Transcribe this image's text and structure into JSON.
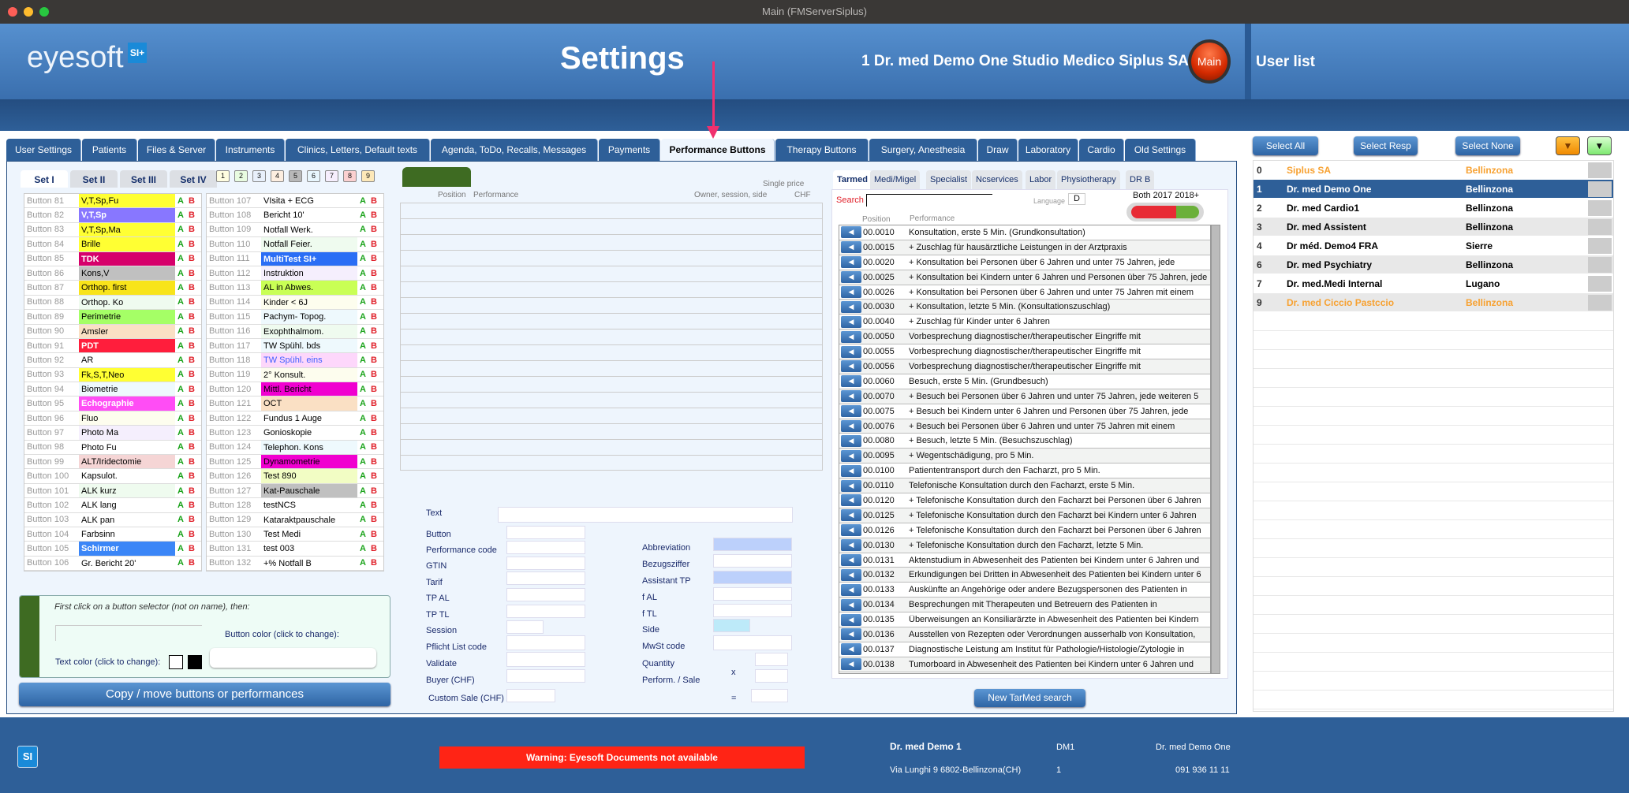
{
  "window": {
    "title": "Main (FMServerSiplus)"
  },
  "header": {
    "logo": "eyesoft",
    "logo_badge": "SI+",
    "title": "Settings",
    "user_clinic": "1 Dr. med Demo One  Studio Medico Siplus SA",
    "main_button": "Main",
    "user_list_title": "User list"
  },
  "tabs": [
    "User Settings",
    "Patients",
    "Files & Server",
    "Instruments",
    "Clinics, Letters, Default texts",
    "Agenda, ToDo, Recalls, Messages",
    "Payments",
    "Performance Buttons",
    "Therapy Buttons",
    "Surgery, Anesthesia",
    "Draw",
    "Laboratory",
    "Cardio",
    "Old Settings"
  ],
  "active_tab": "Performance Buttons",
  "sets": [
    "Set I",
    "Set II",
    "Set III",
    "Set IV"
  ],
  "pages": [
    {
      "n": "1",
      "c": "#fffde0"
    },
    {
      "n": "2",
      "c": "#e8fbe0"
    },
    {
      "n": "3",
      "c": "#e8f0fb"
    },
    {
      "n": "4",
      "c": "#fdeee0"
    },
    {
      "n": "5",
      "c": "#b8b8b8"
    },
    {
      "n": "6",
      "c": "#e8f6fd"
    },
    {
      "n": "7",
      "c": "#f6eefd"
    },
    {
      "n": "8",
      "c": "#fbd0d0"
    },
    {
      "n": "9",
      "c": "#fde8b8"
    }
  ],
  "ab": {
    "a": "A",
    "b": "B"
  },
  "buttons_left": [
    [
      "Button 81",
      "V,T,Sp,Fu",
      "#ffff33",
      "#000"
    ],
    [
      "Button 82",
      "V,T,Sp",
      "#8877ff",
      "#fff"
    ],
    [
      "Button 83",
      "V,T,Sp,Ma",
      "#ffff33",
      "#000"
    ],
    [
      "Button 84",
      "Brille",
      "#ffff33",
      "#000"
    ],
    [
      "Button 85",
      "TDK",
      "#d6006b",
      "#fff"
    ],
    [
      "Button 86",
      "Kons,V",
      "#c0c0c0",
      "#000"
    ],
    [
      "Button 87",
      "Orthop. first",
      "#f8e41a",
      "#000"
    ],
    [
      "Button 88",
      "Orthop. Ko",
      "#effbef",
      "#000"
    ],
    [
      "Button 89",
      "Perimetrie",
      "#a5ff66",
      "#000"
    ],
    [
      "Button 90",
      "Amsler",
      "#fae0c4",
      "#000"
    ],
    [
      "Button 91",
      "PDT",
      "#ff1e3c",
      "#fff"
    ],
    [
      "Button 92",
      "AR",
      "#ffffff",
      "#000"
    ],
    [
      "Button 93",
      "Fk,S,T,Neo",
      "#ffff33",
      "#000"
    ],
    [
      "Button 94",
      "Biometrie",
      "#eef9fd",
      "#000"
    ],
    [
      "Button 95",
      "Echographie",
      "#ff4df5",
      "#fff"
    ],
    [
      "Button 96",
      "Fluo",
      "#fdfdee",
      "#000"
    ],
    [
      "Button 97",
      "Photo Ma",
      "#f5effd",
      "#000"
    ],
    [
      "Button 98",
      "Photo Fu",
      "#ffffff",
      "#000"
    ],
    [
      "Button 99",
      "ALT/Iridectomie",
      "#f5d5d5",
      "#000"
    ],
    [
      "Button 100",
      "Kapsulot.",
      "#ffffff",
      "#000"
    ],
    [
      "Button 101",
      "ALK kurz",
      "#effbef",
      "#000"
    ],
    [
      "Button 102",
      "ALK lang",
      "#ffffff",
      "#000"
    ],
    [
      "Button 103",
      "ALK pan",
      "#ffffff",
      "#000"
    ],
    [
      "Button 104",
      "Farbsinn",
      "#ffffff",
      "#000"
    ],
    [
      "Button 105",
      "Schirmer",
      "#3b86f7",
      "#fff"
    ],
    [
      "Button 106",
      "Gr. Bericht 20'",
      "#ffffff",
      "#000"
    ]
  ],
  "buttons_right": [
    [
      "Button 107",
      "VIsita + ECG",
      "#ffffff",
      "#000"
    ],
    [
      "Button 108",
      "Bericht 10'",
      "#ffffff",
      "#000"
    ],
    [
      "Button 109",
      "Notfall Werk.",
      "#ffffff",
      "#000"
    ],
    [
      "Button 110",
      "Notfall Feier.",
      "#effbef",
      "#000"
    ],
    [
      "Button 111",
      "MultiTest SI+",
      "#2a6ef5",
      "#fff"
    ],
    [
      "Button 112",
      "Instruktion",
      "#f5effd",
      "#000"
    ],
    [
      "Button 113",
      "AL in Abwes.",
      "#c9ff55",
      "#000"
    ],
    [
      "Button 114",
      "Kinder < 6J",
      "#fdfdee",
      "#000"
    ],
    [
      "Button 115",
      "Pachym- Topog.",
      "#eef9fd",
      "#000"
    ],
    [
      "Button 116",
      "Exophthalmom.",
      "#effbef",
      "#000"
    ],
    [
      "Button 117",
      "TW Spühl. bds",
      "#eef9fd",
      "#000"
    ],
    [
      "Button 118",
      "TW Spühl. eins",
      "#fdd7fb",
      "#4060ff"
    ],
    [
      "Button 119",
      "2° Konsult.",
      "#fdfdee",
      "#000"
    ],
    [
      "Button 120",
      "Mittl. Bericht",
      "#f000d0",
      "#000"
    ],
    [
      "Button 121",
      "OCT",
      "#fae0c4",
      "#000"
    ],
    [
      "Button 122",
      "Fundus 1 Auge",
      "#ffffff",
      "#000"
    ],
    [
      "Button 123",
      "Gonioskopie",
      "#ffffff",
      "#000"
    ],
    [
      "Button 124",
      "Telephon. Kons",
      "#eef9fd",
      "#000"
    ],
    [
      "Button 125",
      "Dynamometrie",
      "#f000d0",
      "#000"
    ],
    [
      "Button 126",
      "Test 890",
      "#f2fdc4",
      "#000"
    ],
    [
      "Button 127",
      "Kat-Pauschale",
      "#c0c0c0",
      "#000"
    ],
    [
      "Button 128",
      "testNCS",
      "#ffffff",
      "#000"
    ],
    [
      "Button 129",
      "Kataraktpauschale",
      "#ffffff",
      "#000"
    ],
    [
      "Button 130",
      "Test Medi",
      "#ffffff",
      "#000"
    ],
    [
      "Button 131",
      "test 003",
      "#ffffff",
      "#000"
    ],
    [
      "Button 132",
      "+% Notfall B",
      "#ffffff",
      "#000"
    ]
  ],
  "color_panel": {
    "hint": "First click on a button selector (not on name), then:",
    "button_color": "Button color (click to change):",
    "text_color": "Text color (click to change):"
  },
  "copy_button": "Copy / move buttons or performances",
  "perf_list": {
    "col_position": "Position",
    "col_performance": "Performance",
    "col_owner": "Owner, session, side",
    "col_price_1": "Single price",
    "col_price_2": "CHF"
  },
  "form": {
    "text": "Text",
    "button": "Button",
    "performance_code": "Performance code",
    "gtin": "GTIN",
    "tarif": "Tarif",
    "tp_al": "TP AL",
    "tp_tl": "TP TL",
    "session": "Session",
    "pflicht": "Pflicht List code",
    "validate": "Validate",
    "buyer": "Buyer (CHF)",
    "custom_sale": "Custom Sale (CHF)",
    "abbreviation": "Abbreviation",
    "bezugsziffer": "Bezugsziffer",
    "assistant_tp": "Assistant TP",
    "f_al": "f AL",
    "f_tl": "f TL",
    "side": "Side",
    "mwst": "MwSt code",
    "quantity": "Quantity",
    "perform_sale": "Perform. / Sale",
    "x": "x",
    "eq": "="
  },
  "tarmed": {
    "tabs": [
      "Tarmed",
      "Medi/Migel",
      "Specialist",
      "Ncservices",
      "Labor",
      "Physiotherapy",
      "DR B"
    ],
    "search_label": "Search",
    "language_label": "Language",
    "language": "D",
    "version_labels": "Both  2017  2018+",
    "col_position": "Position",
    "col_performance": "Performance",
    "new_search": "New TarMed search",
    "rows": [
      [
        "00.0010",
        "Konsultation, erste 5 Min. (Grundkonsultation)"
      ],
      [
        "00.0015",
        "+ Zuschlag für hausärztliche Leistungen in der Arztpraxis"
      ],
      [
        "00.0020",
        "+ Konsultation bei Personen über 6 Jahren und unter 75 Jahren, jede"
      ],
      [
        "00.0025",
        "+ Konsultation bei Kindern unter 6 Jahren und Personen über 75 Jahren, jede"
      ],
      [
        "00.0026",
        "+ Konsultation bei Personen über 6 Jahren und unter 75 Jahren mit einem"
      ],
      [
        "00.0030",
        "+ Konsultation, letzte 5 Min. (Konsultationszuschlag)"
      ],
      [
        "00.0040",
        "+ Zuschlag für Kinder unter 6 Jahren"
      ],
      [
        "00.0050",
        "Vorbesprechung diagnostischer/therapeutischer Eingriffe mit"
      ],
      [
        "00.0055",
        "Vorbesprechung diagnostischer/therapeutischer Eingriffe mit"
      ],
      [
        "00.0056",
        "Vorbesprechung diagnostischer/therapeutischer Eingriffe mit"
      ],
      [
        "00.0060",
        "Besuch, erste 5 Min. (Grundbesuch)"
      ],
      [
        "00.0070",
        "+ Besuch bei Personen über 6 Jahren und unter 75 Jahren, jede weiteren 5"
      ],
      [
        "00.0075",
        "+ Besuch bei Kindern unter 6 Jahren und Personen über 75 Jahren, jede"
      ],
      [
        "00.0076",
        "+ Besuch bei Personen über 6 Jahren und unter 75 Jahren mit einem"
      ],
      [
        "00.0080",
        "+ Besuch, letzte 5 Min. (Besuchszuschlag)"
      ],
      [
        "00.0095",
        "+ Wegentschädigung, pro 5 Min."
      ],
      [
        "00.0100",
        "Patiententransport durch den Facharzt, pro 5 Min."
      ],
      [
        "00.0110",
        "Telefonische Konsultation durch den Facharzt, erste 5 Min."
      ],
      [
        "00.0120",
        "+ Telefonische Konsultation durch den Facharzt bei Personen über 6 Jahren"
      ],
      [
        "00.0125",
        "+ Telefonische Konsultation durch den Facharzt bei Kindern unter 6 Jahren"
      ],
      [
        "00.0126",
        "+ Telefonische Konsultation durch den Facharzt bei Personen über 6 Jahren"
      ],
      [
        "00.0130",
        "+ Telefonische Konsultation durch den Facharzt, letzte 5 Min."
      ],
      [
        "00.0131",
        "Aktenstudium in Abwesenheit des Patienten bei Kindern unter 6 Jahren und"
      ],
      [
        "00.0132",
        "Erkundigungen bei Dritten in Abwesenheit des Patienten bei Kindern unter 6"
      ],
      [
        "00.0133",
        "Auskünfte an Angehörige oder andere Bezugspersonen des Patienten in"
      ],
      [
        "00.0134",
        "Besprechungen mit Therapeuten und Betreuern des Patienten in"
      ],
      [
        "00.0135",
        "Überweisungen an Konsiliarärzte in Abwesenheit des Patienten bei Kindern"
      ],
      [
        "00.0136",
        "Ausstellen von Rezepten oder Verordnungen ausserhalb von Konsultation,"
      ],
      [
        "00.0137",
        "Diagnostische Leistung am Institut für Pathologie/Histologie/Zytologie in"
      ],
      [
        "00.0138",
        "Tumorboard in Abwesenheit des Patienten bei Kindern unter 6 Jahren und"
      ]
    ]
  },
  "userlist": {
    "select_all": "Select All",
    "select_resp": "Select Resp",
    "select_none": "Select None",
    "users": [
      {
        "n": "0",
        "name": "Siplus SA",
        "city": "Bellinzona",
        "color": "#f7a131"
      },
      {
        "n": "1",
        "name": "Dr. med Demo One",
        "city": "Bellinzona",
        "color": "#ffffff",
        "selected": true
      },
      {
        "n": "2",
        "name": "Dr. med Cardio1",
        "city": "Bellinzona",
        "color": "#000000"
      },
      {
        "n": "3",
        "name": "Dr. med Assistent",
        "city": "Bellinzona",
        "color": "#000000"
      },
      {
        "n": "4",
        "name": "Dr méd. Demo4 FRA",
        "city": "Sierre",
        "color": "#000000"
      },
      {
        "n": "6",
        "name": "Dr. med Psychiatry",
        "city": "Bellinzona",
        "color": "#000000"
      },
      {
        "n": "7",
        "name": "Dr. med.Medi Internal",
        "city": "Lugano",
        "color": "#000000"
      },
      {
        "n": "9",
        "name": "Dr. med Ciccio Pastccio",
        "city": "Bellinzona",
        "color": "#f7a131"
      }
    ]
  },
  "footer": {
    "warning": "Warning: Eyesoft Documents not available",
    "doctor": "Dr. med Demo 1",
    "address": "Via Lunghi 9 6802-Bellinzona(CH)",
    "code": "DM1",
    "code_num": "1",
    "user": "Dr. med Demo One",
    "phone": "091 936 11 11"
  }
}
